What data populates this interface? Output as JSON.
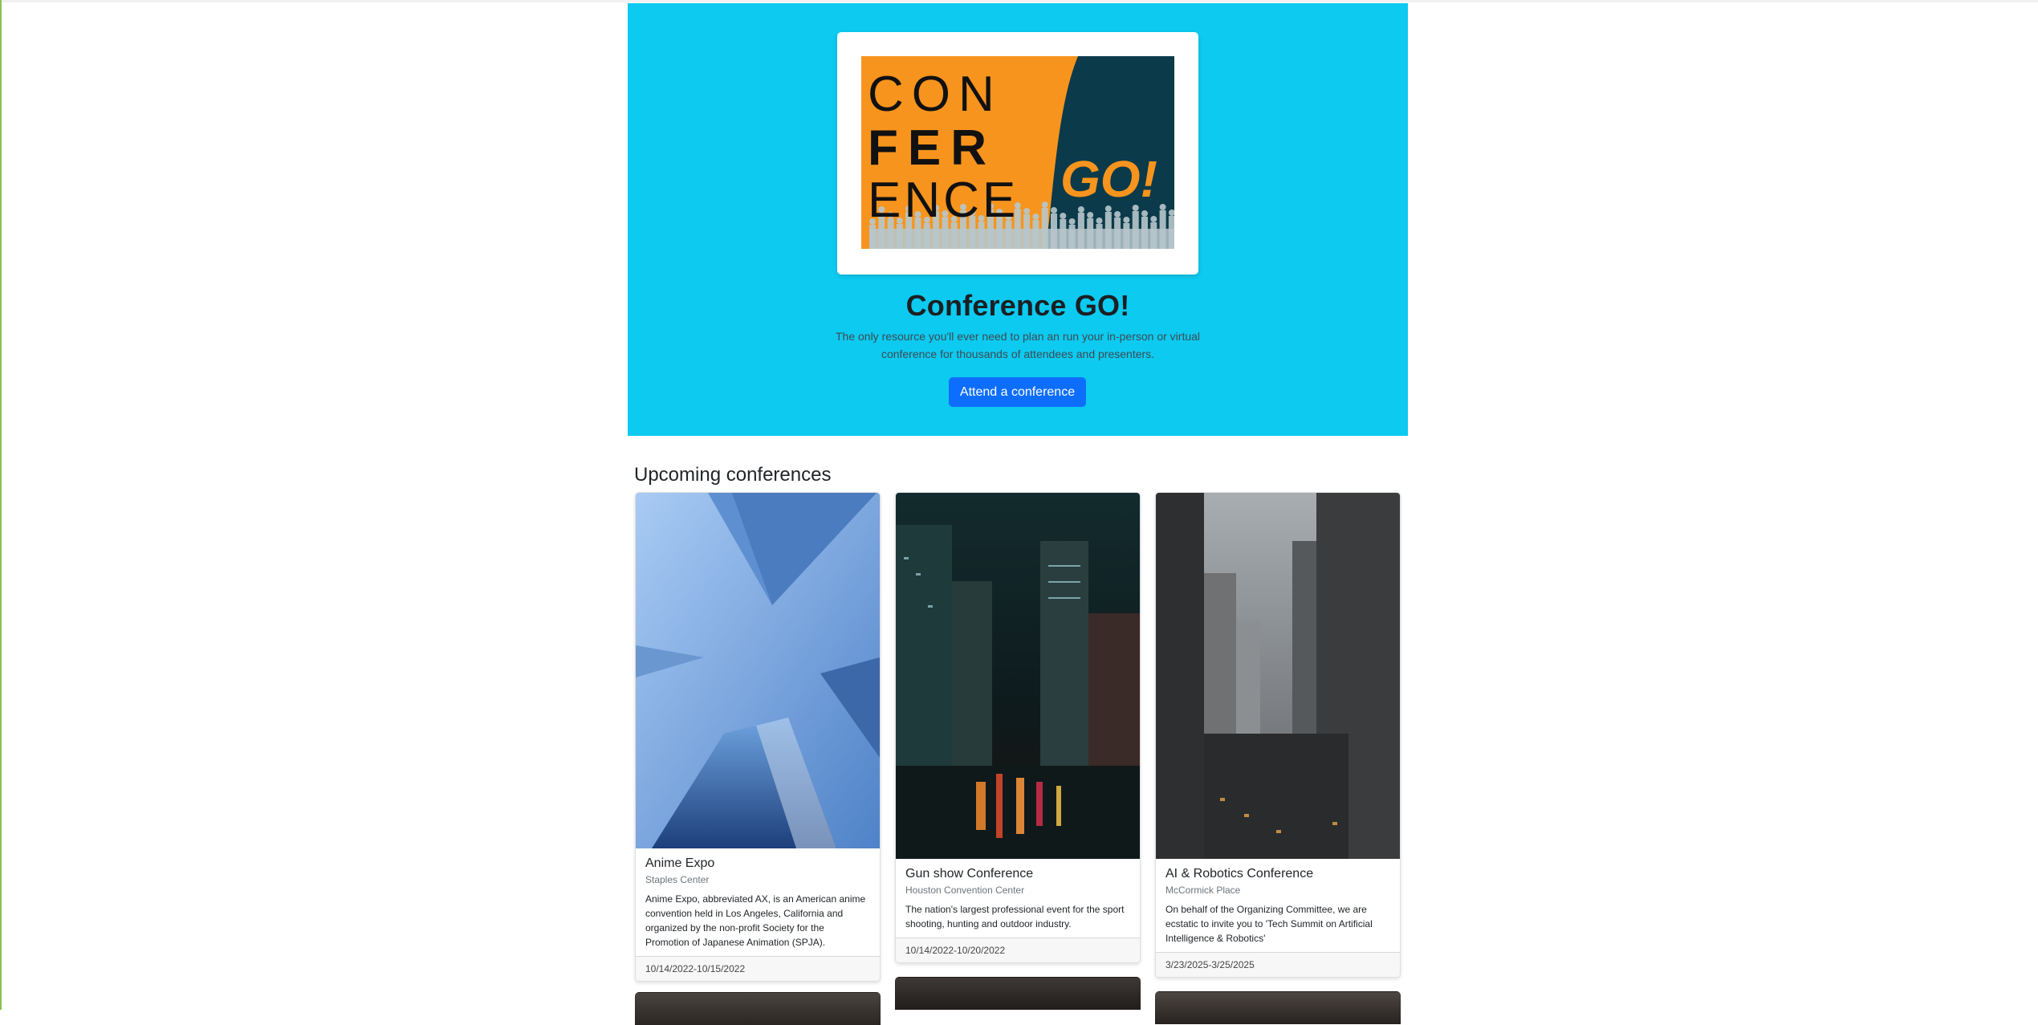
{
  "hero": {
    "logo": {
      "line1": "CON",
      "line2": "FER",
      "line3": "ENCE",
      "go": "GO!"
    },
    "title": "Conference GO!",
    "description": "The only resource you'll ever need to plan an run your in-person or virtual conference for thousands of attendees and presenters.",
    "button_label": "Attend a conference"
  },
  "section": {
    "title": "Upcoming conferences"
  },
  "conferences": [
    {
      "title": "Anime Expo",
      "location": "Staples Center",
      "description": "Anime Expo, abbreviated AX, is an American anime convention held in Los Angeles, California and organized by the non-profit Society for the Promotion of Japanese Animation (SPJA).",
      "dates": "10/14/2022-10/15/2022"
    },
    {
      "title": "Gun show Conference",
      "location": "Houston Convention Center",
      "description": "The nation's largest professional event for the sport shooting, hunting and outdoor industry.",
      "dates": "10/14/2022-10/20/2022"
    },
    {
      "title": "AI & Robotics Conference",
      "location": "McCormick Place",
      "description": "On behalf of the Organizing Committee, we are ecstatic to invite you to 'Tech Summit on Artificial Intelligence & Robotics'",
      "dates": "3/23/2025-3/25/2025"
    }
  ],
  "colors": {
    "hero_bg": "#0dcaf0",
    "button_bg": "#0d6efd",
    "logo_orange": "#f7941d",
    "logo_teal": "#0b3a4a"
  }
}
